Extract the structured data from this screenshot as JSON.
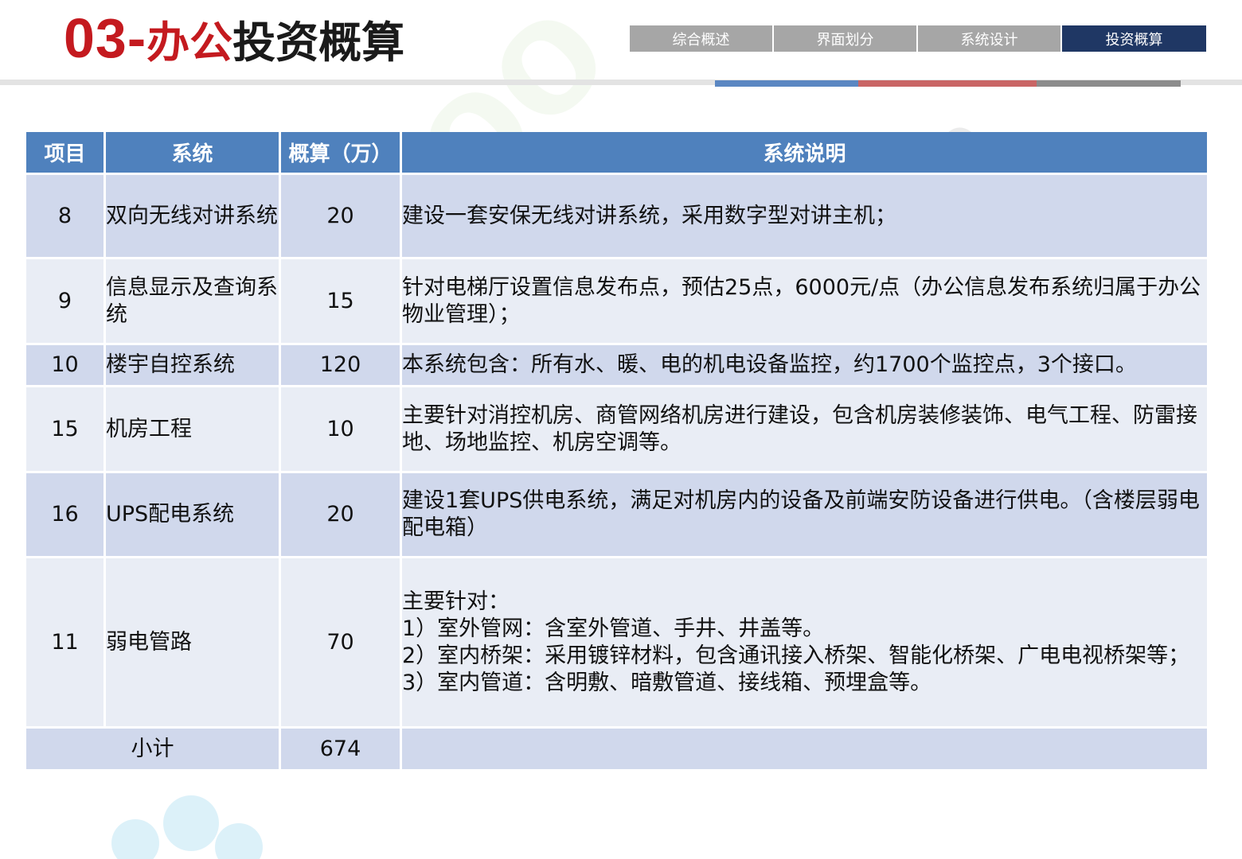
{
  "header": {
    "title_num": "03-",
    "title_red": "办公",
    "title_black": "投资概算"
  },
  "nav": {
    "tabs": [
      "综合概述",
      "界面划分",
      "系统设计",
      "投资概算"
    ],
    "active_index": 3
  },
  "table": {
    "headers": [
      "项目",
      "系统",
      "概算（万）",
      "系统说明"
    ],
    "rows": [
      {
        "item": "8",
        "system": "双向无线对讲系统",
        "amount": "20",
        "desc": [
          "建设一套安保无线对讲系统，采用数字型对讲主机；"
        ]
      },
      {
        "item": "9",
        "system": "信息显示及查询系统",
        "amount": "15",
        "desc": [
          "针对电梯厅设置信息发布点，预估25点，6000元/点（办公信息发布系统归属于办公物业管理）；"
        ]
      },
      {
        "item": "10",
        "system": "楼宇自控系统",
        "amount": "120",
        "desc": [
          "本系统包含：所有水、暖、电的机电设备监控，约1700个监控点，3个接口。"
        ]
      },
      {
        "item": "15",
        "system": "机房工程",
        "amount": "10",
        "desc": [
          "主要针对消控机房、商管网络机房进行建设，包含机房装修装饰、电气工程、防雷接地、场地监控、机房空调等。"
        ]
      },
      {
        "item": "16",
        "system": "UPS配电系统",
        "amount": "20",
        "desc": [
          "建设1套UPS供电系统，满足对机房内的设备及前端安防设备进行供电。（含楼层弱电配电箱）"
        ]
      },
      {
        "item": "11",
        "system": "弱电管路",
        "amount": "70",
        "desc": [
          "主要针对：",
          "1）室外管网：含室外管道、手井、井盖等。",
          "2）室内桥架：采用镀锌材料，包含通讯接入桥架、智能化桥架、广电电视桥架等；",
          "3）室内管道：含明敷、暗敷管道、接线箱、预埋盒等。"
        ]
      }
    ],
    "subtotal": {
      "label": "小计",
      "amount": "674",
      "desc": ""
    }
  },
  "colors": {
    "title_red": "#c41a1f",
    "header_blue": "#4f81bd",
    "row_odd": "#d0d8ec",
    "row_even": "#e9edf5",
    "nav_gray": "#a6a6a6",
    "nav_active": "#1f3764"
  }
}
